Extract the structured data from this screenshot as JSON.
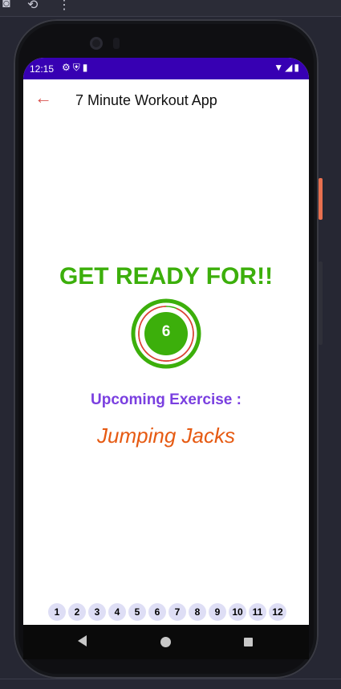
{
  "status_bar": {
    "time": "12:15",
    "left_icons": [
      "gear-icon",
      "shield-icon",
      "sd-card-icon"
    ],
    "right_icons": [
      "wifi-icon",
      "signal-icon",
      "battery-icon"
    ],
    "color": "#3700b3"
  },
  "app_bar": {
    "title": "7 Minute Workout App",
    "back_icon": "arrow-left-icon"
  },
  "main": {
    "ready_title": "GET READY FOR!!",
    "timer_value": "6",
    "upcoming_label": "Upcoming Exercise :",
    "exercise_name": "Jumping Jacks"
  },
  "exercise_steps": [
    "1",
    "2",
    "3",
    "4",
    "5",
    "6",
    "7",
    "8",
    "9",
    "10",
    "11",
    "12"
  ],
  "colors": {
    "accent_green": "#3caf0b",
    "upcoming_purple": "#7a3fe0",
    "exercise_orange": "#e65a12",
    "back_arrow": "#d9534f",
    "timer_progress": "#e53935",
    "step_background": "#dedef5"
  }
}
